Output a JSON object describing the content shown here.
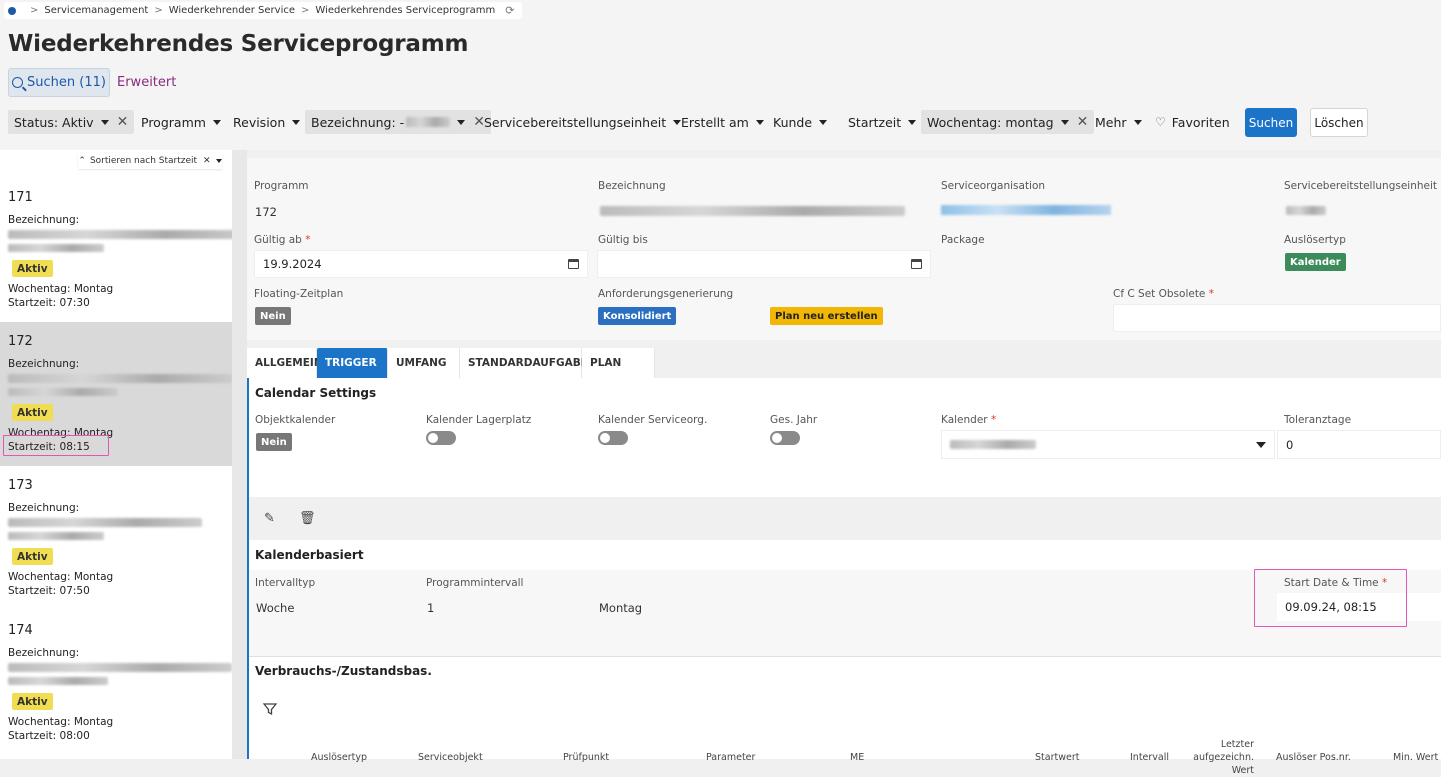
{
  "breadcrumb": [
    "Servicemanagement",
    "Wiederkehrender Service",
    "Wiederkehrendes Serviceprogramm"
  ],
  "page_title": "Wiederkehrendes Serviceprogramm",
  "search": {
    "tab_label": "Suchen (11)",
    "extended_label": "Erweitert"
  },
  "filters": {
    "status": "Status: Aktiv",
    "programm": "Programm",
    "revision": "Revision",
    "bezeichnung": "Bezeichnung: -",
    "servicebereitstellungseinheit": "Servicebereitstellungseinheit",
    "erstellt_am": "Erstellt am",
    "kunde": "Kunde",
    "startzeit": "Startzeit",
    "wochentag": "Wochentag: montag",
    "mehr": "Mehr",
    "favoriten": "Favoriten",
    "suchen_btn": "Suchen",
    "loeschen_btn": "Löschen"
  },
  "sort": {
    "label": "Sortieren nach Startzeit"
  },
  "list": {
    "items": [
      {
        "num": "171",
        "bez_label": "Bezeichnung:",
        "status": "Aktiv",
        "wochentag": "Wochentag:   Montag",
        "startzeit": "Startzeit:   07:30"
      },
      {
        "num": "172",
        "bez_label": "Bezeichnung:",
        "status": "Aktiv",
        "wochentag": "Wochentag:   Montag",
        "startzeit": "Startzeit:   08:15"
      },
      {
        "num": "173",
        "bez_label": "Bezeichnung:",
        "status": "Aktiv",
        "wochentag": "Wochentag:   Montag",
        "startzeit": "Startzeit:   07:50"
      },
      {
        "num": "174",
        "bez_label": "Bezeichnung:",
        "status": "Aktiv",
        "wochentag": "Wochentag:   Montag",
        "startzeit": "Startzeit:   08:00"
      }
    ]
  },
  "detail": {
    "programm_label": "Programm",
    "programm_value": "172",
    "bezeichnung_label": "Bezeichnung",
    "serviceorganisation_label": "Serviceorganisation",
    "sbe_label": "Servicebereitstellungseinheit",
    "gueltig_ab_label": "Gültig ab",
    "gueltig_ab_value": "19.9.2024",
    "gueltig_bis_label": "Gültig bis",
    "package_label": "Package",
    "ausloesertyp_label": "Auslösertyp",
    "ausloesertyp_value": "Kalender",
    "floating_label": "Floating-Zeitplan",
    "floating_value": "Nein",
    "anforderung_label": "Anforderungsgenerierung",
    "anforderung_value": "Konsolidiert",
    "plan_neu_label": "Plan neu erstellen",
    "cfc_label": "Cf C Set Obsolete",
    "required_mark": "*"
  },
  "tabs": [
    "ALLGEMEIN",
    "TRIGGER",
    "UMFANG",
    "STANDARDAUFGABEN",
    "PLAN"
  ],
  "calendar_settings": {
    "title": "Calendar Settings",
    "objektkalender_label": "Objektkalender",
    "objektkalender_value": "Nein",
    "lagerplatz_label": "Kalender Lagerplatz",
    "serviceorg_label": "Kalender Serviceorg.",
    "gesjahr_label": "Ges. Jahr",
    "kalender_label": "Kalender",
    "toleranz_label": "Toleranztage",
    "toleranz_value": "0"
  },
  "kalenderbasiert": {
    "title": "Kalenderbasiert",
    "intervalltyp_label": "Intervalltyp",
    "intervalltyp_value": "Woche",
    "programmintervall_label": "Programmintervall",
    "programmintervall_value": "1",
    "wochentag_value": "Montag",
    "start_label": "Start Date & Time",
    "start_value": "09.09.24, 08:15"
  },
  "verbrauch": {
    "title": "Verbrauchs-/Zustandsbas.",
    "columns": [
      "Auslösertyp",
      "Serviceobjekt",
      "Prüfpunkt",
      "Parameter",
      "ME",
      "Startwert",
      "Intervall",
      "Letzter aufgezeichn. Wert",
      "Auslöser Pos.nr.",
      "Min. Wert"
    ]
  },
  "colors": {
    "accent": "#1c74c9",
    "highlight": "#e455b8",
    "active_badge": "#f1dd52"
  }
}
